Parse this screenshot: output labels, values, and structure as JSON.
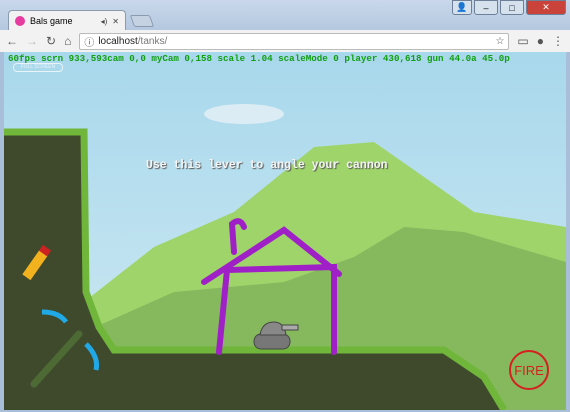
{
  "browser": {
    "tab_title": "Bals game",
    "address_host": "localhost",
    "address_path": "/tanks/"
  },
  "game": {
    "debug_text": "60fps scrn 933,593cam 0,0 myCam 0,158 scale 1.04 scaleMode 0 player 430,618 gun 44.0a 45.0p",
    "fullscreen_label": "FULL SCREEN",
    "hint": "Use this lever to angle your cannon",
    "fire_label": "FIRE",
    "drawing_color": "#a020c8",
    "fire_color": "#d62020"
  }
}
